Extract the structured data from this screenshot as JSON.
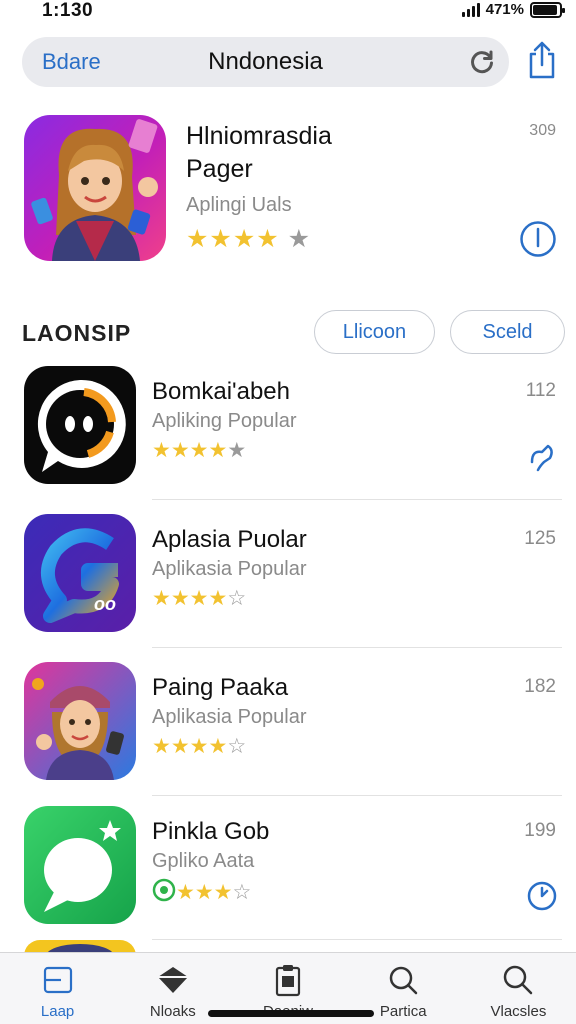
{
  "status": {
    "time": "1:130",
    "battery": "471%"
  },
  "header": {
    "back_label": "Bdare",
    "title": "Nndonesia"
  },
  "featured": {
    "title_line1": "Hlniomrasdia",
    "title_line2": "Pager",
    "subtitle": "Aplingi Uals",
    "stars": "★★★★",
    "stars_off": "★",
    "number": "309"
  },
  "section": {
    "label": "LAONSIP",
    "pill1": "Llicoon",
    "pill2": "Sceld"
  },
  "apps": [
    {
      "name": "Bomkai'abeh",
      "subtitle": "Apliking Popular",
      "stars": "★★★★",
      "stars_off": "★",
      "number": "112"
    },
    {
      "name": "Aplasia Puolar",
      "subtitle": "Aplikasia Popular",
      "stars": "★★★★",
      "stars_off": "☆",
      "number": "125"
    },
    {
      "name": "Paing Paaka",
      "subtitle": "Aplikasia Popular",
      "stars": "★★★★",
      "stars_off": "☆",
      "number": "182"
    },
    {
      "name": "Pinkla Gob",
      "subtitle": "Gpliko Aata",
      "stars": "★★★",
      "stars_off": "☆",
      "number": "199"
    }
  ],
  "tabs": [
    {
      "label": "Laap"
    },
    {
      "label": "Nloaks"
    },
    {
      "label": "Daeniw"
    },
    {
      "label": "Partica"
    },
    {
      "label": "Vlacsles"
    }
  ],
  "colors": {
    "accent": "#2a6fc7",
    "star": "#f2c230",
    "search_bg": "#e9eaee"
  }
}
